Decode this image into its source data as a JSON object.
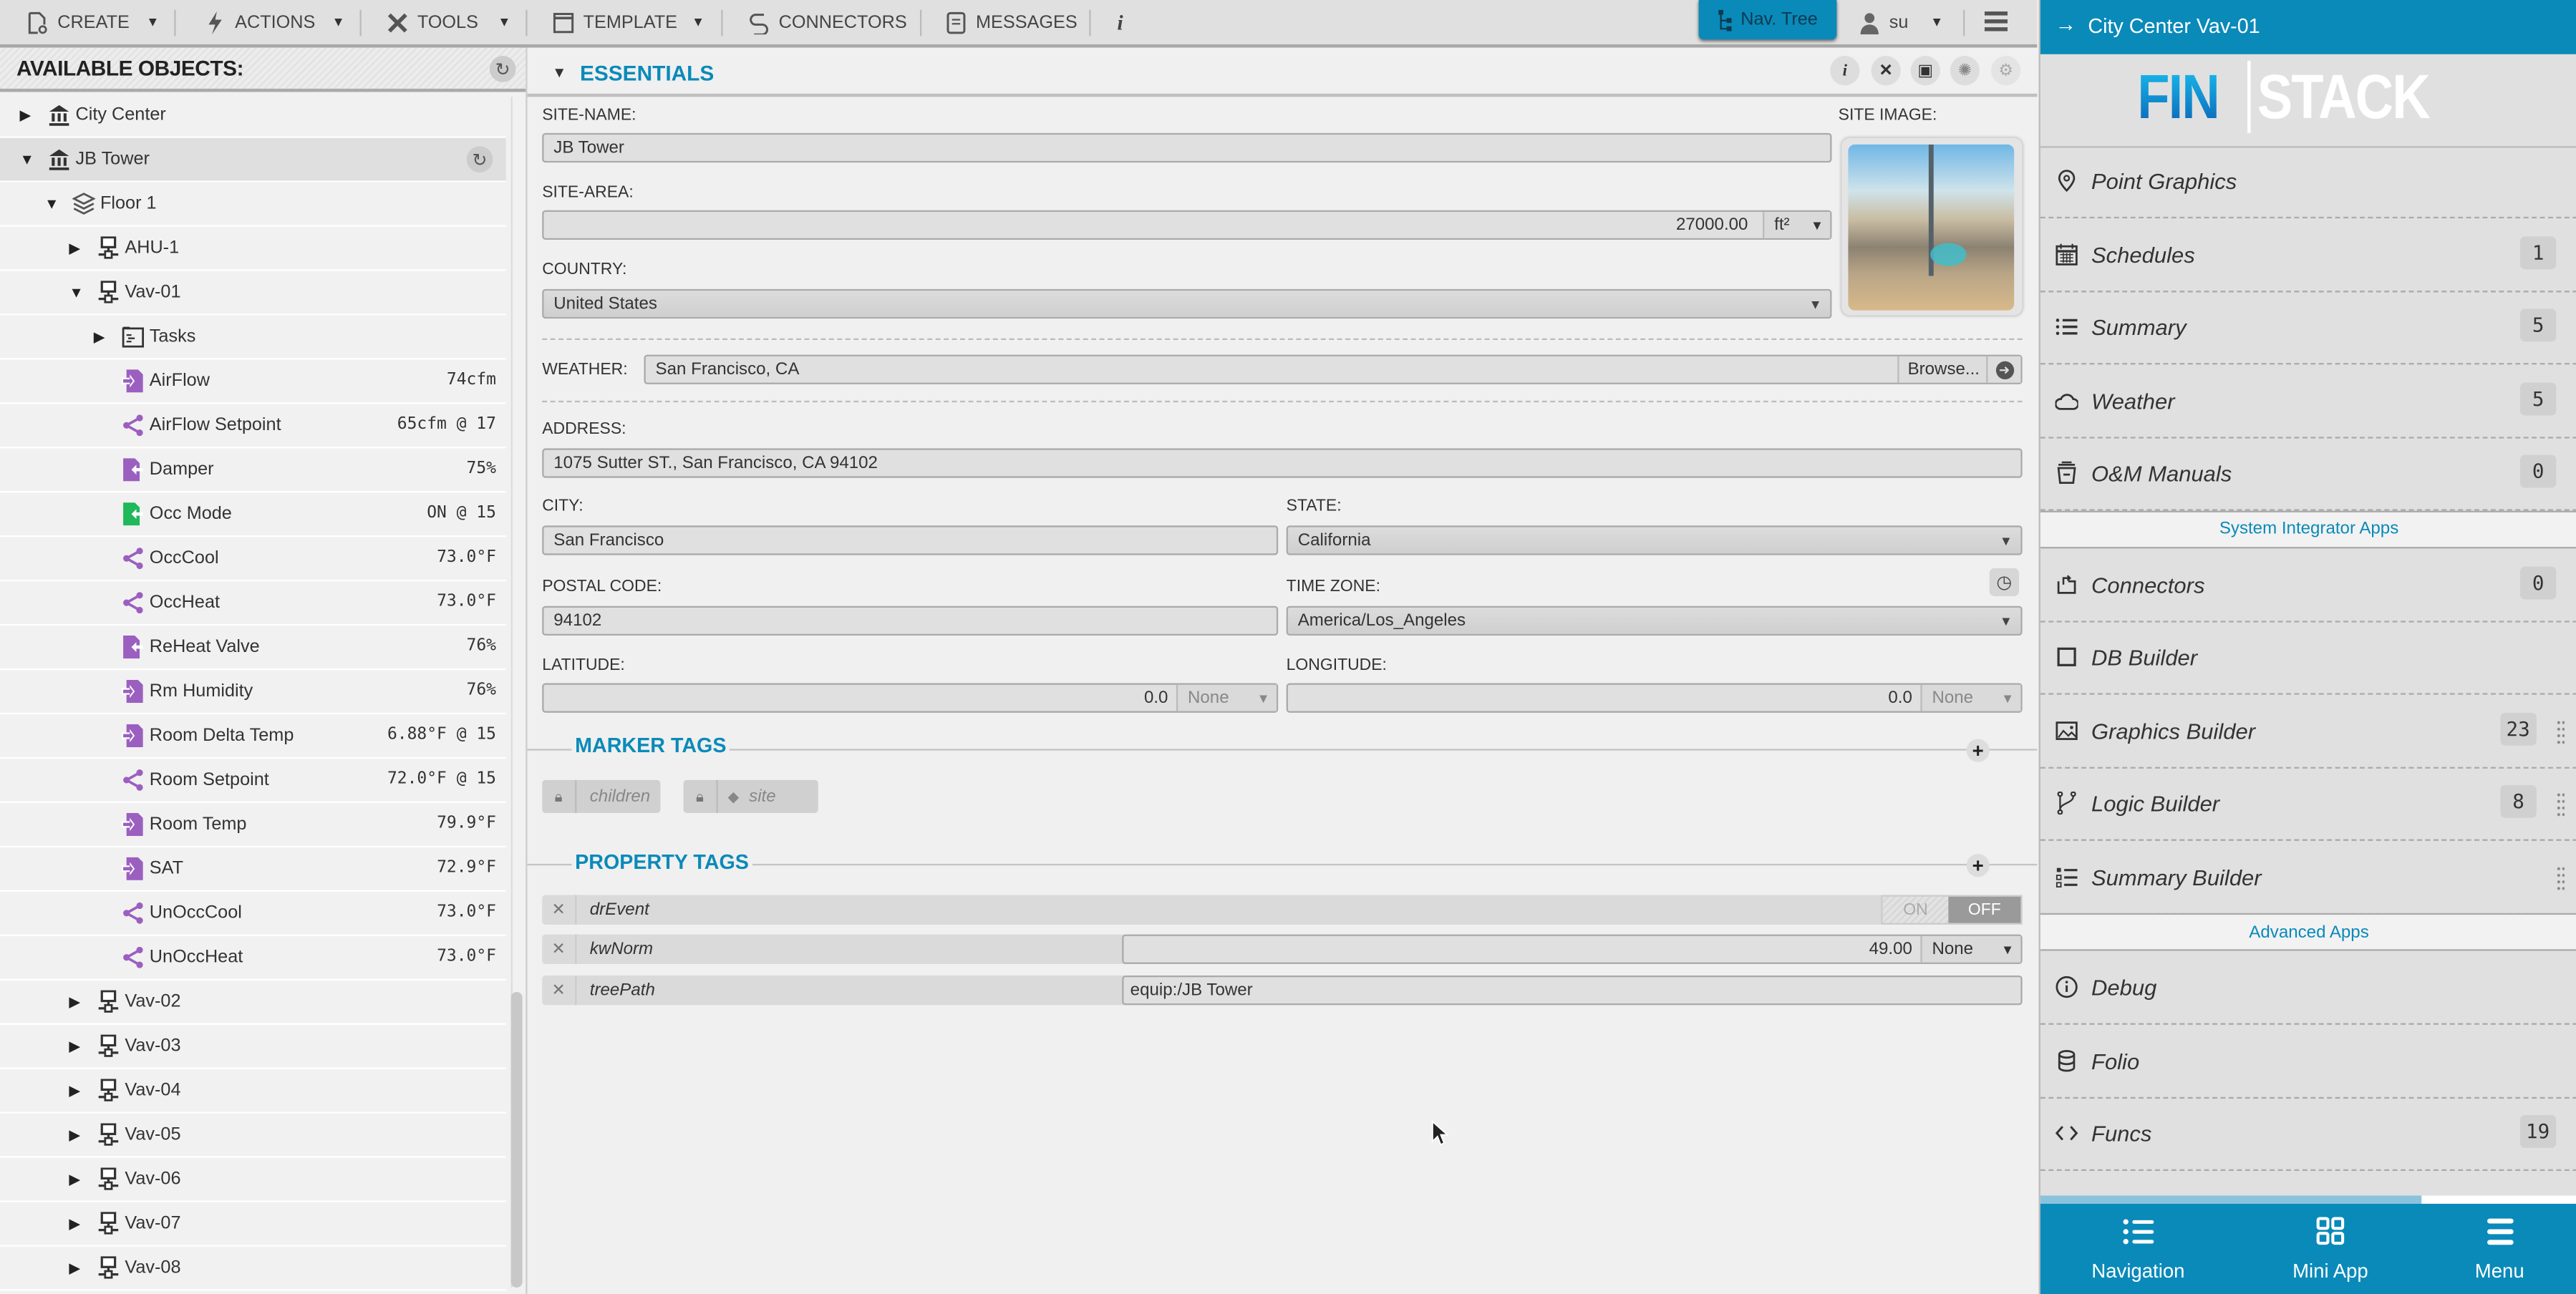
{
  "toolbar": {
    "items": [
      {
        "label": "CREATE",
        "icon": "new-document-icon",
        "has_dropdown": true
      },
      {
        "label": "ACTIONS",
        "icon": "lightning-icon",
        "has_dropdown": true
      },
      {
        "label": "TOOLS",
        "icon": "tools-icon",
        "has_dropdown": true
      },
      {
        "label": "TEMPLATE",
        "icon": "template-icon",
        "has_dropdown": true
      },
      {
        "label": "CONNECTORS",
        "icon": "connector-icon",
        "has_dropdown": false
      },
      {
        "label": "MESSAGES",
        "icon": "messages-icon",
        "has_dropdown": false
      },
      {
        "label": "i",
        "icon": "info-icon",
        "has_dropdown": false
      }
    ],
    "nav_tree_label": "Nav. Tree",
    "user_label": "su"
  },
  "tree": {
    "title": "AVAILABLE OBJECTS:",
    "rows": [
      {
        "label": "City Center",
        "type": "site",
        "expand": "collapsed",
        "depth": 0,
        "value": ""
      },
      {
        "label": "JB Tower",
        "type": "site",
        "expand": "expanded",
        "depth": 0,
        "value": "",
        "selected": true
      },
      {
        "label": "Floor 1",
        "type": "floor",
        "expand": "expanded",
        "depth": 1,
        "value": ""
      },
      {
        "label": "AHU-1",
        "type": "equip",
        "expand": "collapsed",
        "depth": 2,
        "value": ""
      },
      {
        "label": "Vav-01",
        "type": "equip",
        "expand": "expanded",
        "depth": 2,
        "value": ""
      },
      {
        "label": "Tasks",
        "type": "tasks",
        "expand": "collapsed",
        "depth": 3,
        "value": ""
      },
      {
        "label": "AirFlow",
        "type": "point-in",
        "expand": "none",
        "depth": 3,
        "value": "74cfm"
      },
      {
        "label": "AirFlow Setpoint",
        "type": "point-sp",
        "expand": "none",
        "depth": 3,
        "value": "65cfm @ 17"
      },
      {
        "label": "Damper",
        "type": "point-out",
        "expand": "none",
        "depth": 3,
        "value": "75%"
      },
      {
        "label": "Occ Mode",
        "type": "point-out-green",
        "expand": "none",
        "depth": 3,
        "value": "ON @ 15"
      },
      {
        "label": "OccCool",
        "type": "point-sp",
        "expand": "none",
        "depth": 3,
        "value": "73.0°F"
      },
      {
        "label": "OccHeat",
        "type": "point-sp",
        "expand": "none",
        "depth": 3,
        "value": "73.0°F"
      },
      {
        "label": "ReHeat Valve",
        "type": "point-out",
        "expand": "none",
        "depth": 3,
        "value": "76%"
      },
      {
        "label": "Rm Humidity",
        "type": "point-in",
        "expand": "none",
        "depth": 3,
        "value": "76%"
      },
      {
        "label": "Room Delta Temp",
        "type": "point-in",
        "expand": "none",
        "depth": 3,
        "value": "6.88°F @ 15"
      },
      {
        "label": "Room Setpoint",
        "type": "point-sp",
        "expand": "none",
        "depth": 3,
        "value": "72.0°F @ 15"
      },
      {
        "label": "Room Temp",
        "type": "point-in",
        "expand": "none",
        "depth": 3,
        "value": "79.9°F"
      },
      {
        "label": "SAT",
        "type": "point-in",
        "expand": "none",
        "depth": 3,
        "value": "72.9°F"
      },
      {
        "label": "UnOccCool",
        "type": "point-sp",
        "expand": "none",
        "depth": 3,
        "value": "73.0°F"
      },
      {
        "label": "UnOccHeat",
        "type": "point-sp",
        "expand": "none",
        "depth": 3,
        "value": "73.0°F"
      },
      {
        "label": "Vav-02",
        "type": "equip",
        "expand": "collapsed",
        "depth": 2,
        "value": ""
      },
      {
        "label": "Vav-03",
        "type": "equip",
        "expand": "collapsed",
        "depth": 2,
        "value": ""
      },
      {
        "label": "Vav-04",
        "type": "equip",
        "expand": "collapsed",
        "depth": 2,
        "value": ""
      },
      {
        "label": "Vav-05",
        "type": "equip",
        "expand": "collapsed",
        "depth": 2,
        "value": ""
      },
      {
        "label": "Vav-06",
        "type": "equip",
        "expand": "collapsed",
        "depth": 2,
        "value": ""
      },
      {
        "label": "Vav-07",
        "type": "equip",
        "expand": "collapsed",
        "depth": 2,
        "value": ""
      },
      {
        "label": "Vav-08",
        "type": "equip",
        "expand": "collapsed",
        "depth": 2,
        "value": ""
      }
    ]
  },
  "essentials": {
    "title": "ESSENTIALS",
    "site_name_label": "SITE-NAME:",
    "site_name": "JB Tower",
    "site_image_label": "SITE IMAGE:",
    "site_area_label": "SITE-AREA:",
    "site_area": "27000.00",
    "site_area_unit": "ft²",
    "country_label": "COUNTRY:",
    "country": "United States",
    "weather_label": "WEATHER:",
    "weather": "San Francisco, CA",
    "browse_label": "Browse...",
    "address_label": "ADDRESS:",
    "address": "1075 Sutter ST., San Francisco, CA  94102",
    "city_label": "CITY:",
    "city": "San Francisco",
    "state_label": "STATE:",
    "state": "California",
    "postal_label": "POSTAL CODE:",
    "postal": "94102",
    "tz_label": "TIME ZONE:",
    "tz": "America/Los_Angeles",
    "lat_label": "LATITUDE:",
    "lat": "0.0",
    "lat_unit": "None",
    "lon_label": "LONGITUDE:",
    "lon": "0.0",
    "lon_unit": "None"
  },
  "marker_tags": {
    "title": "MARKER TAGS",
    "tags": [
      {
        "label": "children",
        "locked": true,
        "tag_icon": false
      },
      {
        "label": "site",
        "locked": true,
        "tag_icon": true
      }
    ]
  },
  "property_tags": {
    "title": "PROPERTY TAGS",
    "rows": [
      {
        "name": "drEvent",
        "kind": "toggle",
        "on_label": "ON",
        "off_label": "OFF",
        "value": "OFF"
      },
      {
        "name": "kwNorm",
        "kind": "number",
        "value": "49.00",
        "unit": "None"
      },
      {
        "name": "treePath",
        "kind": "text",
        "value": "equip:/JB Tower"
      }
    ]
  },
  "sidebar": {
    "title": "City Center Vav-01",
    "logo_left": "FIN",
    "logo_right": "STACK",
    "apps": [
      {
        "label": "Point Graphics",
        "icon": "map-pin-icon",
        "badge": null
      },
      {
        "label": "Schedules",
        "icon": "calendar-icon",
        "badge": "1"
      },
      {
        "label": "Summary",
        "icon": "list-icon",
        "badge": "5"
      },
      {
        "label": "Weather",
        "icon": "cloud-icon",
        "badge": "5"
      },
      {
        "label": "O&M Manuals",
        "icon": "archive-icon",
        "badge": "0"
      }
    ],
    "group1_title": "System Integrator Apps",
    "si_apps": [
      {
        "label": "Connectors",
        "icon": "connector-icon",
        "badge": "0",
        "drag": false
      },
      {
        "label": "DB Builder",
        "icon": "square-icon",
        "badge": null,
        "drag": false
      },
      {
        "label": "Graphics Builder",
        "icon": "image-icon",
        "badge": "23",
        "drag": true
      },
      {
        "label": "Logic Builder",
        "icon": "branch-icon",
        "badge": "8",
        "drag": true
      },
      {
        "label": "Summary Builder",
        "icon": "checklist-icon",
        "badge": null,
        "drag": true
      }
    ],
    "group2_title": "Advanced Apps",
    "adv_apps": [
      {
        "label": "Debug",
        "icon": "info-circle-icon",
        "badge": null
      },
      {
        "label": "Folio",
        "icon": "database-icon",
        "badge": null
      },
      {
        "label": "Funcs",
        "icon": "code-icon",
        "badge": "19"
      }
    ],
    "scroll_progress": 0.71,
    "bottom_nav": [
      {
        "label": "Navigation",
        "icon": "list-icon"
      },
      {
        "label": "Mini App",
        "icon": "grid-icon"
      },
      {
        "label": "Menu",
        "icon": "hamburger-icon",
        "active": true
      }
    ]
  },
  "colors": {
    "accent": "#0a8ab9",
    "point_purple": "#9b5fc0",
    "point_green": "#1fb85a"
  }
}
